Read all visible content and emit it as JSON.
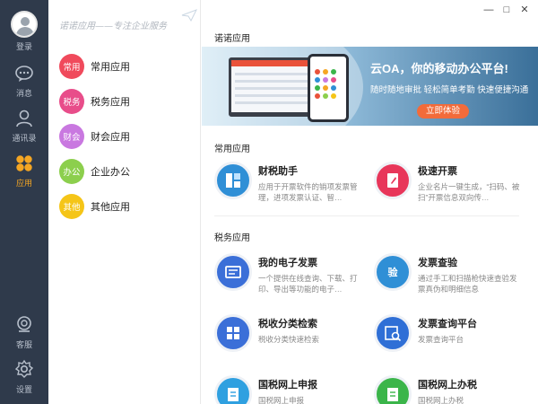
{
  "rail": {
    "login_label": "登录",
    "items": [
      {
        "id": "messages",
        "label": "消息",
        "icon": "chat-bubble-icon"
      },
      {
        "id": "contacts",
        "label": "通讯录",
        "icon": "person-icon"
      },
      {
        "id": "apps",
        "label": "应用",
        "icon": "apps-petals-icon",
        "active": true
      }
    ],
    "bottom": [
      {
        "id": "support",
        "label": "客服",
        "icon": "headset-icon"
      },
      {
        "id": "settings",
        "label": "设置",
        "icon": "gear-icon"
      }
    ]
  },
  "categories": {
    "slogan": "诺诺应用——专注企业服务",
    "items": [
      {
        "badge": "常用",
        "label": "常用应用",
        "color": "#f04a5c"
      },
      {
        "badge": "税务",
        "label": "税务应用",
        "color": "#e84d8a"
      },
      {
        "badge": "财会",
        "label": "财会应用",
        "color": "#c978e0"
      },
      {
        "badge": "办公",
        "label": "企业办公",
        "color": "#8ccf4d"
      },
      {
        "badge": "其他",
        "label": "其他应用",
        "color": "#f5c518"
      }
    ]
  },
  "window": {
    "minimize": "—",
    "maximize": "□",
    "close": "✕"
  },
  "main": {
    "header": "诺诺应用",
    "banner": {
      "title": "云OA，你的移动办公平台!",
      "subtitle": "随时随地审批 轻松简单考勤 快速便捷沟通",
      "button": "立即体验"
    },
    "common_section": "常用应用",
    "common_apps": [
      {
        "title": "财税助手",
        "desc": "应用于开票软件的销项发票管理，进项发票认证、智…",
        "icon": "finance-helper-icon",
        "color": "#2f8fd6"
      },
      {
        "title": "极速开票",
        "desc": "企业名片一键生成，“扫码、被扫”开票信息双向传…",
        "icon": "rocket-invoice-icon",
        "color": "#e8365a"
      }
    ],
    "tax_section": "税务应用",
    "tax_apps": [
      {
        "title": "我的电子发票",
        "desc": "一个提供在线查询、下载、打印、导出等功能的电子…",
        "icon": "e-invoice-icon",
        "color": "#3b6fd8"
      },
      {
        "title": "发票查验",
        "desc": "通过手工和扫描枪快速查验发票真伪和明细信息",
        "icon": "invoice-verify-icon",
        "color": "#2f8fd6",
        "badge": "验"
      },
      {
        "title": "税收分类检索",
        "desc": "税收分类快速检索",
        "icon": "tax-category-icon",
        "color": "#3b6fd8"
      },
      {
        "title": "发票查询平台",
        "desc": "发票查询平台",
        "icon": "invoice-query-icon",
        "color": "#2f6fd6"
      },
      {
        "title": "国税网上申报",
        "desc": "国税网上申报",
        "icon": "online-declare-icon",
        "color": "#2fa0e0"
      },
      {
        "title": "国税网上办税",
        "desc": "国税网上办税",
        "icon": "online-tax-icon",
        "color": "#3bb54a"
      }
    ]
  }
}
